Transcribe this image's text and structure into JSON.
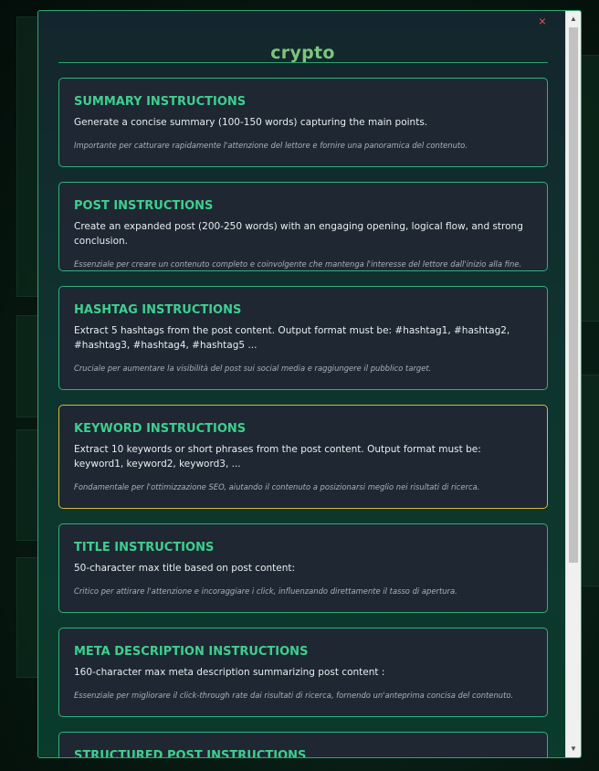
{
  "modal": {
    "title": "crypto",
    "close_icon": "close-icon",
    "close_label": "×"
  },
  "sections": [
    {
      "heading": "SUMMARY INSTRUCTIONS",
      "body": "Generate a concise summary (100-150 words) capturing the main points.",
      "note": "Importante per catturare rapidamente l'attenzione del lettore e fornire una panoramica del contenuto."
    },
    {
      "heading": "POST INSTRUCTIONS",
      "body": "Create an expanded post (200-250 words) with an engaging opening, logical flow, and strong conclusion.",
      "note": "Essenziale per creare un contenuto completo e coinvolgente che mantenga l'interesse del lettore dall'inizio alla fine."
    },
    {
      "heading": "HASHTAG INSTRUCTIONS",
      "body": "Extract 5 hashtags from the post content. Output format must be: #hashtag1, #hashtag2, #hashtag3, #hashtag4, #hashtag5 ...",
      "note": "Cruciale per aumentare la visibilità del post sui social media e raggiungere il pubblico target."
    },
    {
      "heading": "KEYWORD INSTRUCTIONS",
      "body": "Extract 10 keywords or short phrases from the post content. Output format must be: keyword1, keyword2, keyword3, ...",
      "note": "Fondamentale per l'ottimizzazione SEO, aiutando il contenuto a posizionarsi meglio nei risultati di ricerca."
    },
    {
      "heading": "TITLE INSTRUCTIONS",
      "body": "50-character max title based on post content:",
      "note": "Critico per attirare l'attenzione e incoraggiare i click, influenzando direttamente il tasso di apertura."
    },
    {
      "heading": "META DESCRIPTION INSTRUCTIONS",
      "body": "160-character max meta description summarizing post content :",
      "note": "Essenziale per migliorare il click-through rate dai risultati di ricerca, fornendo un'anteprima concisa del contenuto."
    },
    {
      "heading": "STRUCTURED POST INSTRUCTIONS"
    }
  ],
  "scrollbar": {
    "up_arrow": "▲",
    "down_arrow": "▼"
  },
  "colors": {
    "accent": "#3ecf8e",
    "title": "#7cc67d",
    "highlight_border": "#d8b83a",
    "close": "#d9544d"
  }
}
